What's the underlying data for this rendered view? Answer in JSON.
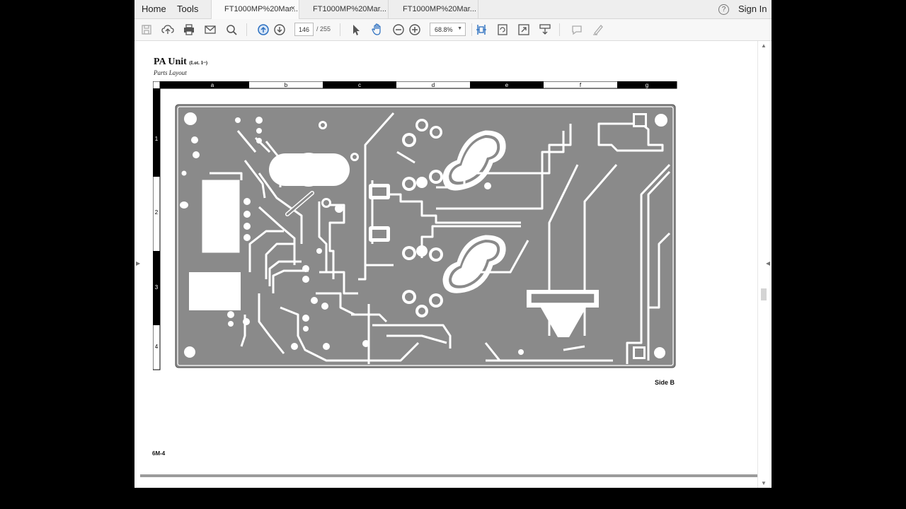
{
  "nav": {
    "home": "Home",
    "tools": "Tools",
    "sign_in": "Sign In"
  },
  "tabs": [
    {
      "label": "FT1000MP%20Mar...",
      "close": "×"
    },
    {
      "label": "FT1000MP%20Mar..."
    },
    {
      "label": "FT1000MP%20Mar..."
    }
  ],
  "toolbar": {
    "page_current": "146",
    "page_total": "/ 255",
    "zoom": "68.8%",
    "icons": [
      "save-icon",
      "upload-icon",
      "print-icon",
      "email-icon",
      "search-icon",
      "prev-page-icon",
      "next-page-icon",
      "select-icon",
      "hand-icon",
      "zoom-out-icon",
      "zoom-in-icon",
      "fit-width-icon",
      "rotate-icon",
      "fullscreen-icon",
      "read-mode-icon",
      "comment-icon",
      "sign-icon"
    ]
  },
  "document": {
    "title": "PA Unit",
    "title_note": "(Lot. 1~)",
    "subtitle": "Parts Layout",
    "side": "Side B",
    "page_label": "6M-4",
    "grid_columns": [
      "a",
      "b",
      "c",
      "d",
      "e",
      "f",
      "g"
    ],
    "grid_rows": [
      "1",
      "2",
      "3",
      "4"
    ]
  },
  "colors": {
    "board": "#8a8a8a",
    "trace": "#ffffff",
    "accent": "#2b6fc0"
  }
}
